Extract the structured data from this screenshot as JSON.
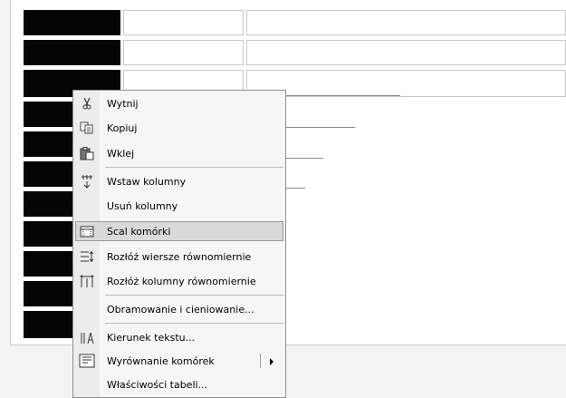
{
  "context_menu": {
    "items": [
      {
        "label": "Wytnij",
        "icon": "cut-icon"
      },
      {
        "label": "Kopiuj",
        "icon": "copy-icon"
      },
      {
        "label": "Wklej",
        "icon": "paste-icon"
      },
      {
        "label": "Wstaw kolumny",
        "icon": "insert-columns-icon"
      },
      {
        "label": "Usuń kolumny",
        "icon": ""
      },
      {
        "label": "Scal komórki",
        "icon": "merge-cells-icon",
        "highlighted": true
      },
      {
        "label": "Rozłóż wiersze równomiernie",
        "icon": "distribute-rows-icon"
      },
      {
        "label": "Rozłóż kolumny równomiernie",
        "icon": "distribute-columns-icon"
      },
      {
        "label": "Obramowanie i cieniowanie...",
        "icon": ""
      },
      {
        "label": "Kierunek tekstu...",
        "icon": "text-direction-icon"
      },
      {
        "label": "Wyrównanie komórek",
        "icon": "cell-alignment-icon",
        "has_submenu": true
      },
      {
        "label": "Właściwości tabeli...",
        "icon": ""
      }
    ]
  },
  "colors": {
    "selected_cell_fill": "#050505",
    "menu_background": "#f6f6f6",
    "menu_highlight": "#d9d9d9"
  }
}
